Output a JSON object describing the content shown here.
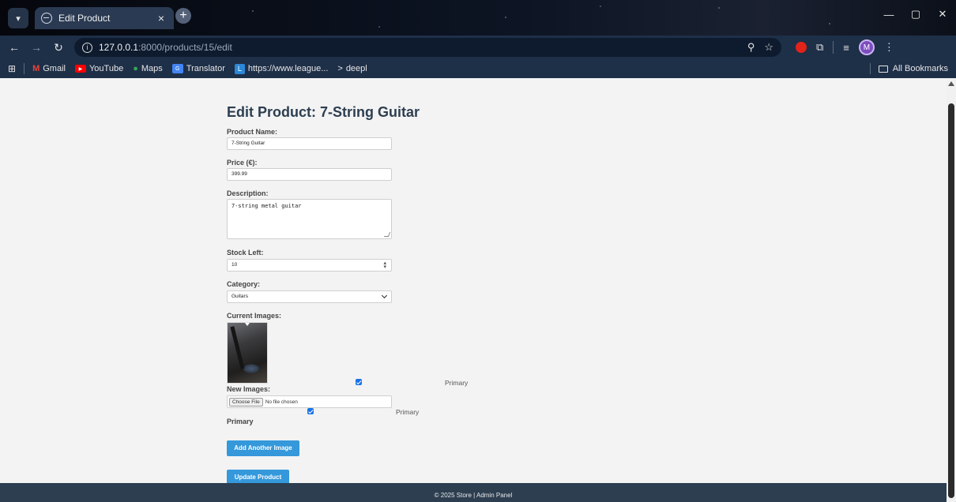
{
  "browser": {
    "tab_title": "Edit Product",
    "tab_close": "×",
    "new_tab": "+",
    "url_host": "127.0.0.1",
    "url_rest": ":8000/products/15/edit",
    "bookmarks": [
      "Gmail",
      "YouTube",
      "Maps",
      "Translator",
      "https://www.league...",
      "deepl"
    ],
    "all_bookmarks": "All Bookmarks",
    "profile_initial": "M"
  },
  "page": {
    "title": "Edit Product: 7-String Guitar",
    "fields": {
      "name_label": "Product Name:",
      "name_value": "7-String Guitar",
      "price_label": "Price (€):",
      "price_value": "399.99",
      "description_label": "Description:",
      "description_value": "7-string metal guitar",
      "stock_label": "Stock Left:",
      "stock_value": "10",
      "category_label": "Category:",
      "category_value": "Guitars",
      "current_images_label": "Current Images:",
      "primary_label": "Primary",
      "new_images_label": "New Images:",
      "choose_file_label": "Choose File",
      "no_file_text": "No file chosen",
      "new_primary_label": "Primary",
      "primary_below_label": "Primary"
    },
    "buttons": {
      "add_image": "Add Another Image",
      "update": "Update Product"
    },
    "footer": "© 2025 Store | Admin Panel"
  }
}
